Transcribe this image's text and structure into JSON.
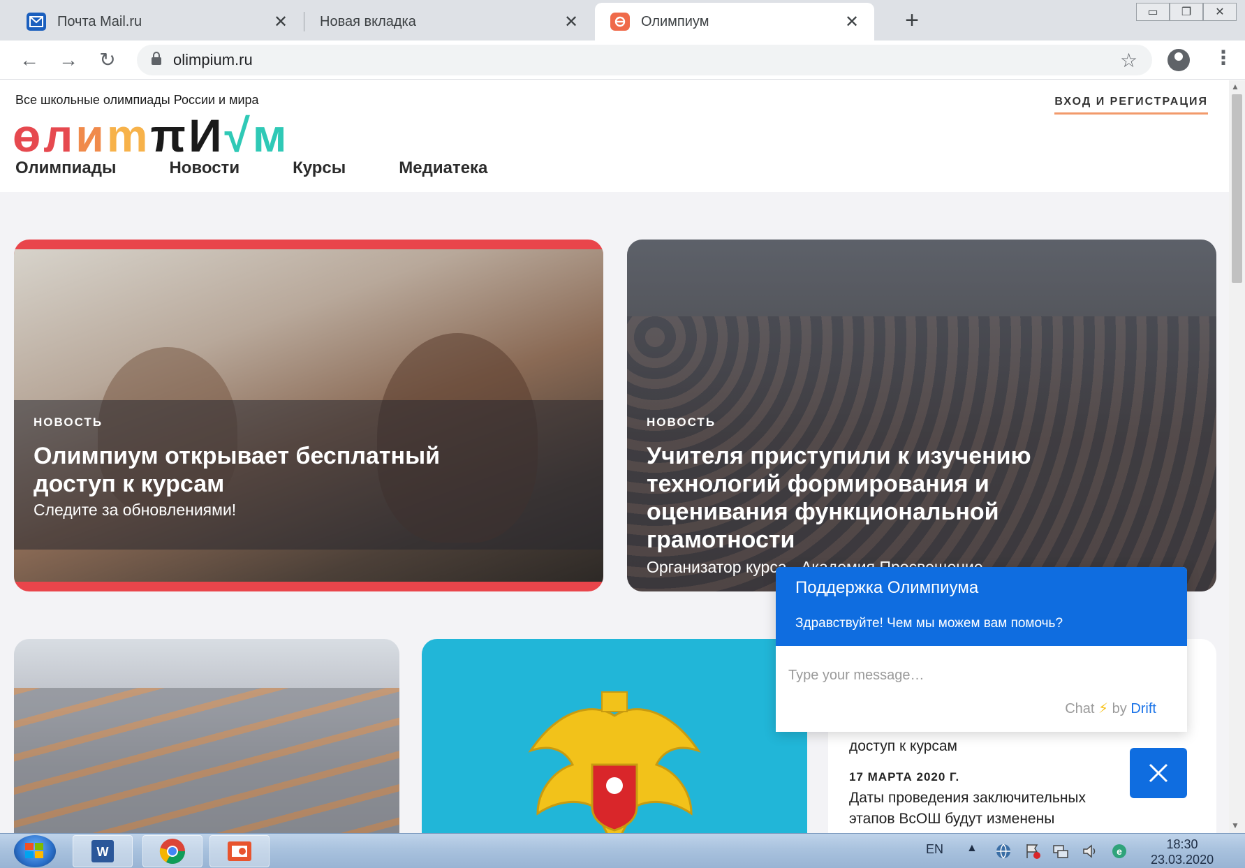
{
  "browser": {
    "tabs": [
      {
        "label": "Почта Mail.ru",
        "icon": "mail-icon"
      },
      {
        "label": "Новая вкладка",
        "icon": ""
      },
      {
        "label": "Олимпиум",
        "icon": "olimpium-favicon",
        "active": true
      }
    ],
    "url": "olimpium.ru",
    "window_controls": [
      "minimize-icon",
      "restore-icon",
      "close-icon"
    ]
  },
  "site": {
    "tagline": "Все школьные олимпиады России и мира",
    "login_label": "ВХОД И РЕГИСТРАЦИЯ",
    "logo_parts": [
      "ө",
      "л",
      "и",
      "m",
      "π",
      "И",
      "√",
      "м"
    ],
    "nav": [
      "Олимпиады",
      "Новости",
      "Курсы",
      "Медиатека"
    ]
  },
  "cards": [
    {
      "kicker": "НОВОСТЬ",
      "title": "Олимпиум открывает бесплатный доступ к курсам",
      "subtitle": "Следите за обновлениями!"
    },
    {
      "kicker": "НОВОСТЬ",
      "title": "Учителя приступили к изучению технологий формирования и оценивания функциональной грамотности",
      "subtitle": "Организатор курса - Академия Просвещение"
    }
  ],
  "news_list": {
    "fragment": "доступ к курсам",
    "date": "17 МАРТА 2020 Г.",
    "title_line1": "Даты проведения заключительных",
    "title_line2": "этапов ВсОШ будут изменены"
  },
  "chat": {
    "title": "Поддержка Олимпиума",
    "greeting": "Здравствуйте! Чем мы можем вам помочь?",
    "placeholder": "Type your message…",
    "brand_prefix": "Chat",
    "brand_by": "by",
    "brand_name": "Drift"
  },
  "taskbar": {
    "lang": "EN",
    "time": "18:30",
    "date": "23.03.2020"
  },
  "colors": {
    "accent_blue": "#0f6de0",
    "card_red": "#e9454b",
    "card_cyan": "#21b6d8",
    "login_underline": "#f29a6b"
  }
}
